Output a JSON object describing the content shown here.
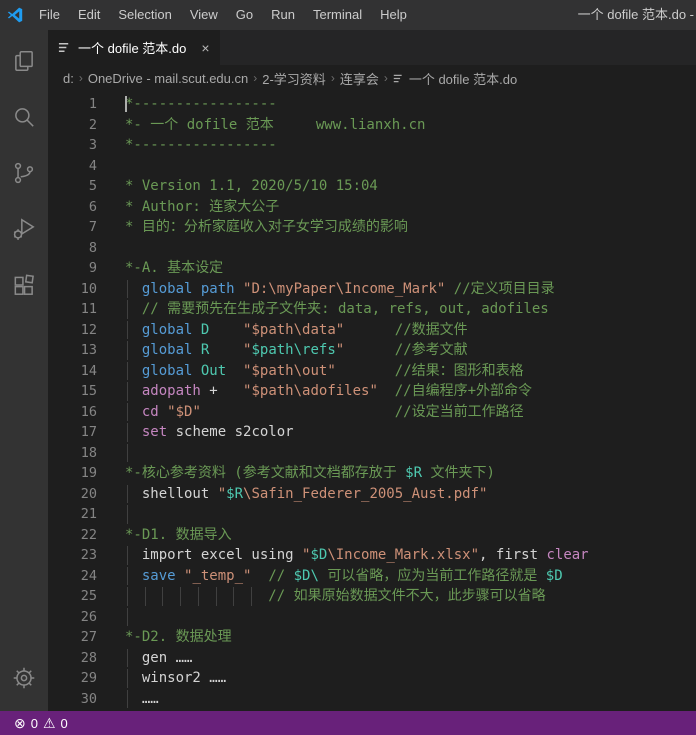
{
  "colors": {
    "title_bar_bg": "#323233",
    "activity_bar_bg": "#333333",
    "tab_strip_bg": "#252526",
    "editor_bg": "#1e1e1e",
    "status_bar_bg": "#68217A",
    "text": "#cccccc",
    "line_number": "#858585",
    "icon": "#8a8a8a",
    "indent_guide": "#404040",
    "comment": "#6A9955",
    "keyword": "#569CD6",
    "type": "#4EC9B0",
    "string": "#CE9178",
    "control": "#C586C0",
    "plain": "#D4D4D4",
    "breadcrumb": "#a9a9a9",
    "logo_blue": "#1f9cf0"
  },
  "title_bar": {
    "menus": [
      "File",
      "Edit",
      "Selection",
      "View",
      "Go",
      "Run",
      "Terminal",
      "Help"
    ],
    "window_title": "一个 dofile 范本.do -"
  },
  "tab": {
    "icon": "do-file",
    "label": "一个 dofile 范本.do",
    "close_label": "×"
  },
  "breadcrumb": {
    "path": [
      "d:",
      "OneDrive - mail.scut.edu.cn",
      "2-学习资料",
      "连享会"
    ],
    "separator": "›",
    "file": "一个 dofile 范本.do"
  },
  "activity_bar": {
    "items": [
      "explorer",
      "search",
      "source-control",
      "run-and-debug",
      "extensions"
    ],
    "bottom": [
      "manage"
    ]
  },
  "status_bar": {
    "errors": "0",
    "warnings": "0"
  },
  "editor": {
    "lines": [
      {
        "n": "1",
        "g": 0,
        "cur": true,
        "t": [
          [
            "cm",
            "*-----------------"
          ]
        ]
      },
      {
        "n": "2",
        "g": 0,
        "t": [
          [
            "cm",
            "*- 一个 dofile 范本     www.lianxh.cn"
          ]
        ]
      },
      {
        "n": "3",
        "g": 0,
        "t": [
          [
            "cm",
            "*-----------------"
          ]
        ]
      },
      {
        "n": "4",
        "g": 0,
        "t": []
      },
      {
        "n": "5",
        "g": 0,
        "t": [
          [
            "cm",
            "* Version 1.1, 2020/5/10 15:04"
          ]
        ]
      },
      {
        "n": "6",
        "g": 0,
        "t": [
          [
            "cm",
            "* Author: 连家大公子"
          ]
        ]
      },
      {
        "n": "7",
        "g": 0,
        "t": [
          [
            "cm",
            "* 目的：分析家庭收入对子女学习成绩的影响"
          ]
        ]
      },
      {
        "n": "8",
        "g": 0,
        "t": []
      },
      {
        "n": "9",
        "g": 0,
        "t": [
          [
            "cm",
            "*-A. 基本设定"
          ]
        ]
      },
      {
        "n": "10",
        "g": 1,
        "t": [
          [
            "pl",
            "  "
          ],
          [
            "kw",
            "global path"
          ],
          [
            "pl",
            " "
          ],
          [
            "st",
            "\"D:\\myPaper\\Income_Mark\""
          ],
          [
            "pl",
            " "
          ],
          [
            "cm",
            "//定义项目目录"
          ]
        ]
      },
      {
        "n": "11",
        "g": 1,
        "t": [
          [
            "pl",
            "  "
          ],
          [
            "cm",
            "// 需要预先在生成子文件夹: data, refs, out, adofiles"
          ]
        ]
      },
      {
        "n": "12",
        "g": 1,
        "t": [
          [
            "pl",
            "  "
          ],
          [
            "kw",
            "global"
          ],
          [
            "pl",
            " "
          ],
          [
            "ty",
            "D"
          ],
          [
            "pl",
            "    "
          ],
          [
            "st",
            "\"$path\\data\""
          ],
          [
            "pl",
            "      "
          ],
          [
            "cm",
            "//数据文件"
          ]
        ]
      },
      {
        "n": "13",
        "g": 1,
        "t": [
          [
            "pl",
            "  "
          ],
          [
            "kw",
            "global"
          ],
          [
            "pl",
            " "
          ],
          [
            "ty",
            "R"
          ],
          [
            "pl",
            "    "
          ],
          [
            "st",
            "\""
          ],
          [
            "ty",
            "$path\\refs"
          ],
          [
            "st",
            "\""
          ],
          [
            "pl",
            "      "
          ],
          [
            "cm",
            "//参考文献"
          ]
        ]
      },
      {
        "n": "14",
        "g": 1,
        "t": [
          [
            "pl",
            "  "
          ],
          [
            "kw",
            "global"
          ],
          [
            "pl",
            " "
          ],
          [
            "ty",
            "Out"
          ],
          [
            "pl",
            "  "
          ],
          [
            "st",
            "\"$path\\out\""
          ],
          [
            "pl",
            "       "
          ],
          [
            "cm",
            "//结果：图形和表格"
          ]
        ]
      },
      {
        "n": "15",
        "g": 1,
        "t": [
          [
            "pl",
            "  "
          ],
          [
            "mg",
            "adopath"
          ],
          [
            "pl",
            " +   "
          ],
          [
            "st",
            "\"$path\\adofiles\""
          ],
          [
            "pl",
            "  "
          ],
          [
            "cm",
            "//自编程序+外部命令"
          ]
        ]
      },
      {
        "n": "16",
        "g": 1,
        "t": [
          [
            "pl",
            "  "
          ],
          [
            "mg",
            "cd"
          ],
          [
            "pl",
            " "
          ],
          [
            "st",
            "\"$D\""
          ],
          [
            "pl",
            "                       "
          ],
          [
            "cm",
            "//设定当前工作路径"
          ]
        ]
      },
      {
        "n": "17",
        "g": 1,
        "t": [
          [
            "pl",
            "  "
          ],
          [
            "mg",
            "set"
          ],
          [
            "pl",
            " scheme s2color"
          ]
        ]
      },
      {
        "n": "18",
        "g": 1,
        "t": []
      },
      {
        "n": "19",
        "g": 0,
        "t": [
          [
            "cm",
            "*-核心参考资料 (参考文献和文档都存放于 "
          ],
          [
            "ty",
            "$R"
          ],
          [
            "cm",
            " 文件夹下)"
          ]
        ]
      },
      {
        "n": "20",
        "g": 1,
        "t": [
          [
            "pl",
            "  shellout "
          ],
          [
            "st",
            "\""
          ],
          [
            "ty",
            "$R"
          ],
          [
            "st",
            "\\Safin_Federer_2005_Aust.pdf\""
          ]
        ]
      },
      {
        "n": "21",
        "g": 1,
        "t": []
      },
      {
        "n": "22",
        "g": 0,
        "t": [
          [
            "cm",
            "*-D1. 数据导入"
          ]
        ]
      },
      {
        "n": "23",
        "g": 1,
        "t": [
          [
            "pl",
            "  import excel using "
          ],
          [
            "st",
            "\""
          ],
          [
            "ty",
            "$D"
          ],
          [
            "st",
            "\\Income_Mark.xlsx\""
          ],
          [
            "pl",
            ", first "
          ],
          [
            "mg",
            "clear"
          ]
        ]
      },
      {
        "n": "24",
        "g": 1,
        "t": [
          [
            "pl",
            "  "
          ],
          [
            "kw",
            "save"
          ],
          [
            "pl",
            " "
          ],
          [
            "st",
            "\"_temp_\""
          ],
          [
            "pl",
            "  "
          ],
          [
            "cm",
            "// "
          ],
          [
            "ty",
            "$D\\"
          ],
          [
            "cm",
            " 可以省略，应为当前工作路径就是 "
          ],
          [
            "ty",
            "$D"
          ]
        ]
      },
      {
        "n": "25",
        "g": 8,
        "t": [
          [
            "pl",
            "                 "
          ],
          [
            "cm",
            "// 如果原始数据文件不大，此步骤可以省略"
          ]
        ]
      },
      {
        "n": "26",
        "g": 1,
        "t": []
      },
      {
        "n": "27",
        "g": 0,
        "t": [
          [
            "cm",
            "*-D2. 数据处理"
          ]
        ]
      },
      {
        "n": "28",
        "g": 1,
        "t": [
          [
            "pl",
            "  gen ……"
          ]
        ]
      },
      {
        "n": "29",
        "g": 1,
        "t": [
          [
            "pl",
            "  winsor2 ……"
          ]
        ]
      },
      {
        "n": "30",
        "g": 1,
        "t": [
          [
            "pl",
            "  ……"
          ]
        ]
      }
    ]
  }
}
